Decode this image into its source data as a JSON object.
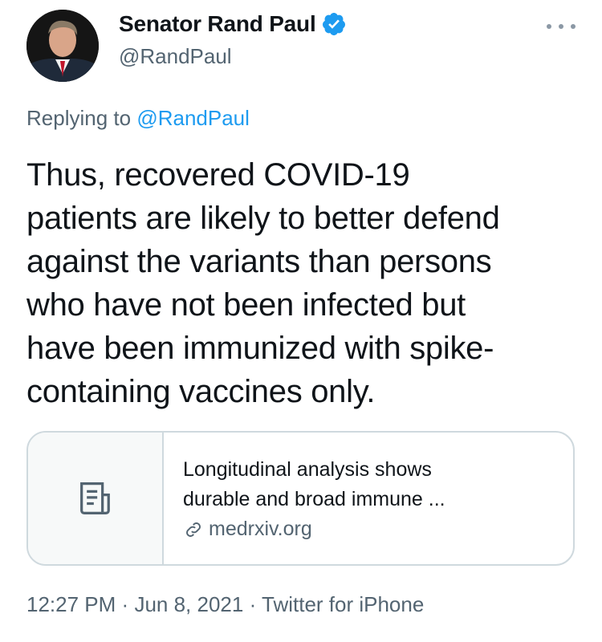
{
  "author": {
    "name": "Senator Rand Paul",
    "handle": "@RandPaul",
    "verified": true
  },
  "reply": {
    "prefix": "Replying to",
    "handle": "@RandPaul"
  },
  "tweet": {
    "lines": [
      "Thus, recovered COVID-19",
      "patients are likely to better defend",
      "against the variants than persons",
      "who have not been infected but",
      "have been immunized with spike-",
      "containing vaccines only."
    ]
  },
  "link_card": {
    "title_line1": "Longitudinal analysis shows",
    "title_line2": "durable and broad immune ...",
    "domain": "medrxiv.org",
    "thumbnail_icon": "document-icon"
  },
  "meta": {
    "time": "12:27 PM",
    "separator": "·",
    "date": "Jun 8, 2021",
    "source": "Twitter for iPhone"
  },
  "colors": {
    "text": "#0f1419",
    "secondary": "#536471",
    "accent": "#1d9bf0",
    "border": "#cfd9de"
  }
}
